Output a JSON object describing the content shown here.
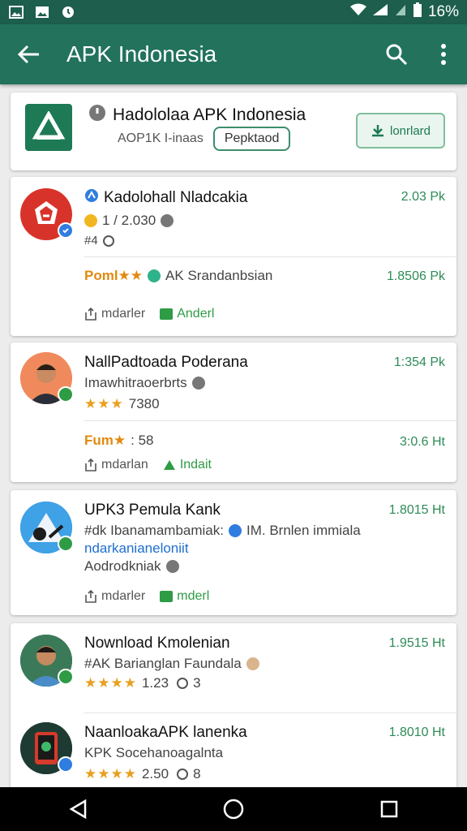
{
  "status_bar": {
    "battery": "16%",
    "left_icons": [
      "gallery-icon",
      "image-icon",
      "notification-icon"
    ],
    "right_icons": [
      "wifi-icon",
      "signal-icon",
      "battery-icon"
    ]
  },
  "app_bar": {
    "title": "APK Indonesia",
    "background": "#22725c"
  },
  "featured": {
    "title": "Hadololaa APK Indonesia",
    "subtitle": "AOP1K I-inaas",
    "pill": "Pepktaod",
    "download": "lonrlard"
  },
  "items": [
    {
      "title": "Kadolohall Nladcakia",
      "size": "2.03 Pk",
      "meta": "1 / 2.030",
      "meta2": "#4",
      "line_a": "Poml★★",
      "line_b": "AK Srandanbsian",
      "size2": "1.8506 Pk",
      "act1": "mdarler",
      "act2": "Anderl"
    },
    {
      "title": "NallPadtoada Poderana",
      "size": "1:354 Pk",
      "sub": "Imawhitraoerbrts",
      "rating": "★★★",
      "rating_val": "7380",
      "line_a": "Fum★",
      "line_b": ": 58",
      "size2": "3:0.6 Ht",
      "act1": "mdarlan",
      "act2": "Indait"
    },
    {
      "title": "UPK3 Pemula Kank",
      "size": "1.8015 Ht",
      "sub": "#dk Ibanamambamiak:",
      "sub_b": "IM. Brnlen immiala",
      "sub_link": "ndarkanianeloniit",
      "line3": "Aodrodkniak",
      "act1": "mdarler",
      "act2": "mderl"
    },
    {
      "title": "Nownload Kmolenian",
      "size": "1.9515 Ht",
      "sub": "#AK Barianglan Faundala",
      "rating": "★★★★",
      "rating_val": "1.23",
      "extra": "3"
    },
    {
      "title": "NaanloakaAPK lanenka",
      "size": "1.8010 Ht",
      "sub": "KPK Socehanoagalnta",
      "rating": "★★★★",
      "rating_val": "2.50",
      "extra": "8"
    }
  ]
}
